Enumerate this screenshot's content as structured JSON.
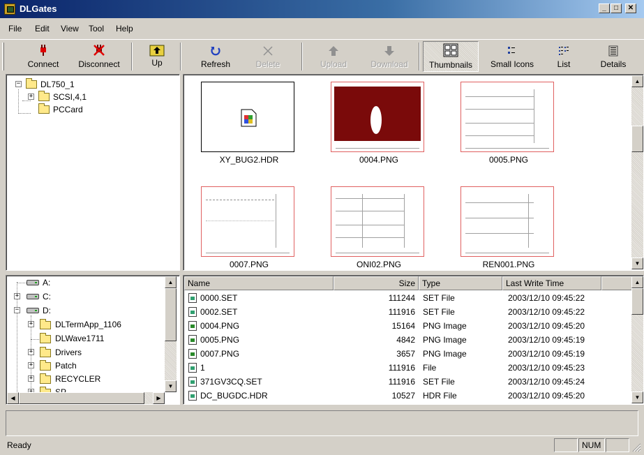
{
  "window": {
    "title": "DLGates",
    "minimize": "_",
    "maximize": "□",
    "close": "✕"
  },
  "menu": [
    "File",
    "Edit",
    "View",
    "Tool",
    "Help"
  ],
  "toolbar": {
    "connect": "Connect",
    "disconnect": "Disconnect",
    "up": "Up",
    "refresh": "Refresh",
    "delete": "Delete",
    "upload": "Upload",
    "download": "Download",
    "thumbnails": "Thumbnails",
    "small_icons": "Small Icons",
    "list": "List",
    "details": "Details",
    "active_view": "Thumbnails"
  },
  "device_tree": {
    "root": "DL750_1",
    "children": [
      "SCSI,4,1",
      "PCCard"
    ]
  },
  "thumbnails": [
    {
      "name": "XY_BUG2.HDR",
      "kind": "file"
    },
    {
      "name": "0004.PNG",
      "kind": "image-dark"
    },
    {
      "name": "0005.PNG",
      "kind": "image"
    },
    {
      "name": "0007.PNG",
      "kind": "image"
    },
    {
      "name": "ONI02.PNG",
      "kind": "image"
    },
    {
      "name": "REN001.PNG",
      "kind": "image"
    }
  ],
  "local_tree": {
    "drives": [
      "A:",
      "C:",
      "D:"
    ],
    "d_children": [
      "DLTermApp_1106",
      "DLWave1711",
      "Drivers",
      "Patch",
      "RECYCLER",
      "SP"
    ]
  },
  "file_list": {
    "columns": [
      "Name",
      "Size",
      "Type",
      "Last Write Time"
    ],
    "rows": [
      {
        "name": "0000.SET",
        "size": "111244",
        "type": "SET File",
        "time": "2003/12/10 09:45:22",
        "icon": "set"
      },
      {
        "name": "0002.SET",
        "size": "111916",
        "type": "SET File",
        "time": "2003/12/10 09:45:22",
        "icon": "set"
      },
      {
        "name": "0004.PNG",
        "size": "15164",
        "type": "PNG Image",
        "time": "2003/12/10 09:45:20",
        "icon": "png"
      },
      {
        "name": "0005.PNG",
        "size": "4842",
        "type": "PNG Image",
        "time": "2003/12/10 09:45:19",
        "icon": "png"
      },
      {
        "name": "0007.PNG",
        "size": "3657",
        "type": "PNG Image",
        "time": "2003/12/10 09:45:19",
        "icon": "png"
      },
      {
        "name": "1",
        "size": "111916",
        "type": "File",
        "time": "2003/12/10 09:45:23",
        "icon": "set"
      },
      {
        "name": "371GV3CQ.SET",
        "size": "111916",
        "type": "SET File",
        "time": "2003/12/10 09:45:24",
        "icon": "set"
      },
      {
        "name": "DC_BUGDC.HDR",
        "size": "10527",
        "type": "HDR File",
        "time": "2003/12/10 09:45:20",
        "icon": "set"
      }
    ]
  },
  "status": {
    "text": "Ready",
    "num": "NUM"
  }
}
